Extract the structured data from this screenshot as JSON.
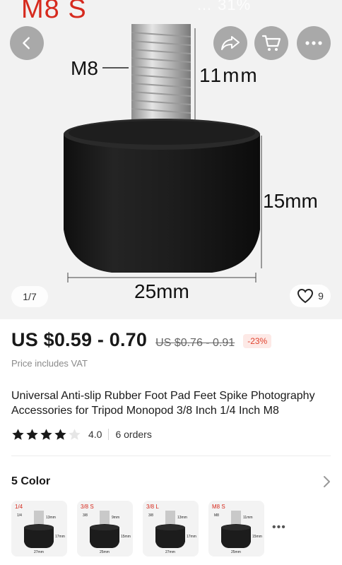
{
  "status_bar": {
    "ghost_text": "… 31%"
  },
  "hero": {
    "variant_overlay": "M8  S",
    "image_counter": "1/7",
    "wishlist_count": "9",
    "dim_thread": "M8",
    "dim_height_thread": "11mm",
    "dim_height_body": "15mm",
    "dim_width": "25mm"
  },
  "price": {
    "current": "US $0.59 - 0.70",
    "original": "US $0.76 - 0.91",
    "discount": "-23%",
    "vat_note": "Price includes VAT"
  },
  "product": {
    "title": "Universal Anti-slip Rubber Foot Pad Feet Spike Photography Accessories for Tripod Monopod 3/8 Inch 1/4 Inch M8",
    "rating": "4.0",
    "rating_value": 4.0,
    "rating_max": 5,
    "orders": "6 orders"
  },
  "colors": {
    "heading": "5 Color",
    "items": [
      {
        "label": "1/4",
        "thread_label": "1/4",
        "h1": "13mm",
        "h2": "17mm",
        "w": "27mm"
      },
      {
        "label": "3/8  S",
        "thread_label": "3/8",
        "h1": "9mm",
        "h2": "15mm",
        "w": "25mm"
      },
      {
        "label": "3/8  L",
        "thread_label": "3/8",
        "h1": "13mm",
        "h2": "17mm",
        "w": "27mm"
      },
      {
        "label": "M8  S",
        "thread_label": "M8",
        "h1": "11mm",
        "h2": "15mm",
        "w": "25mm"
      }
    ],
    "more": "•••"
  },
  "theme": {
    "accent_red": "#d62a1e",
    "discount_red": "#e0432f",
    "star_color": "#191919"
  }
}
